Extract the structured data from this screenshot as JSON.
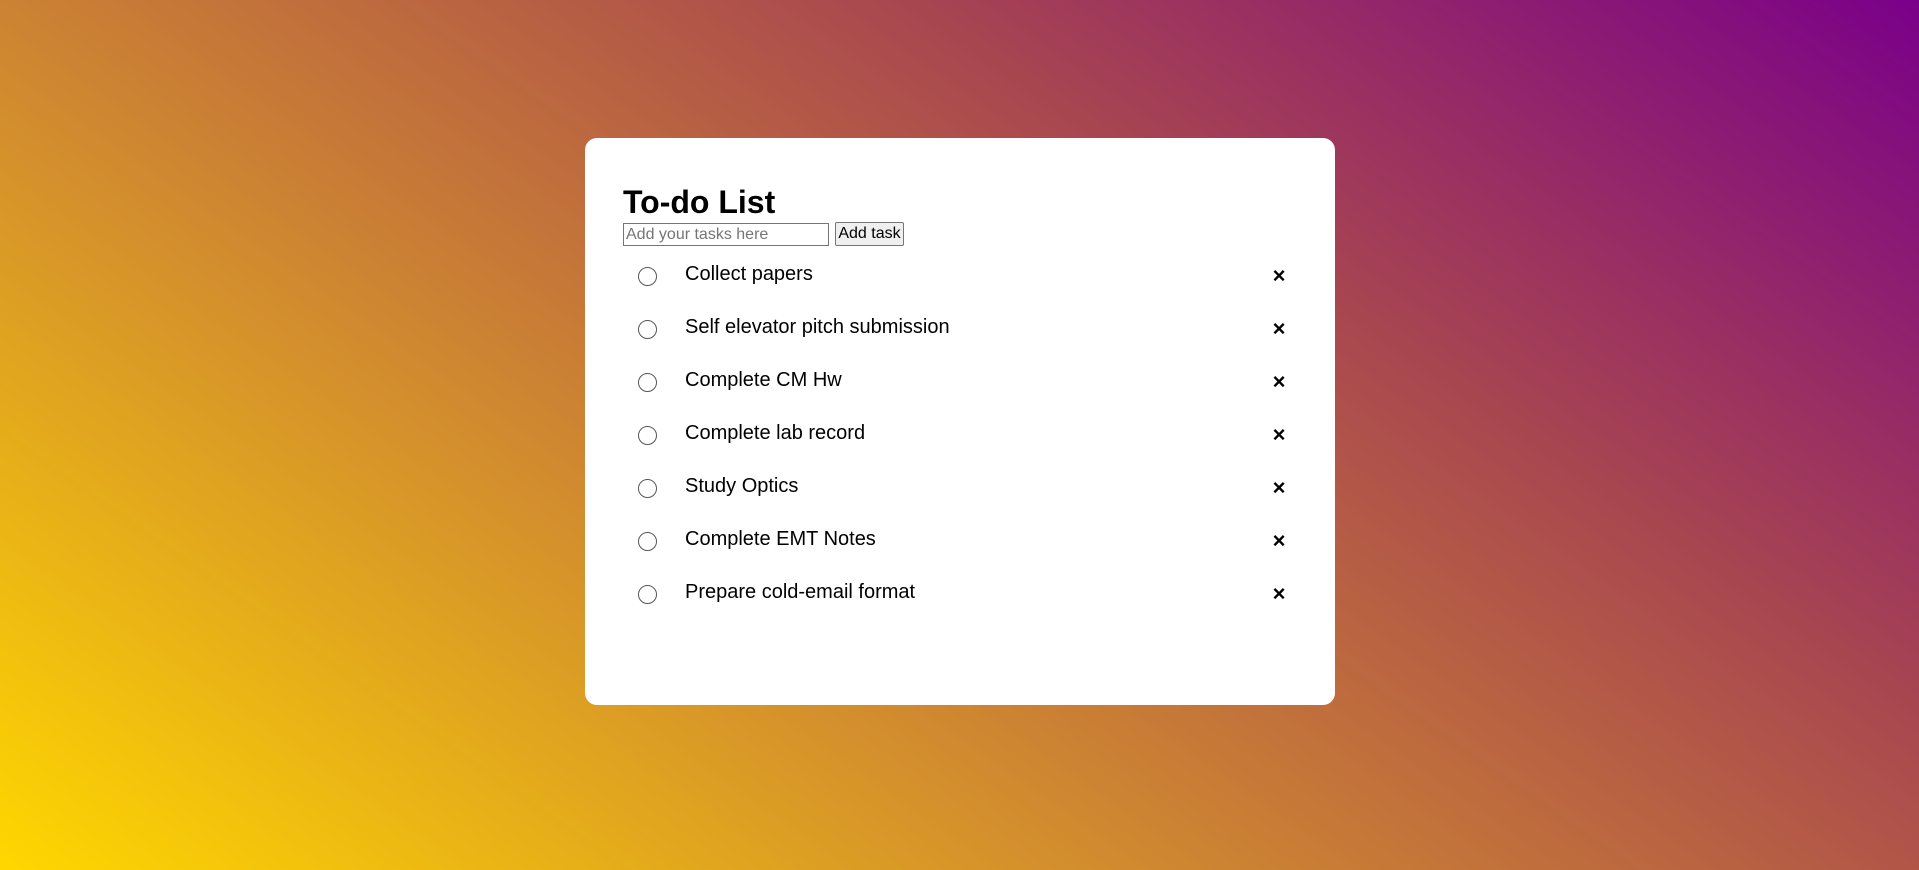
{
  "app": {
    "title": "To-do List"
  },
  "input": {
    "placeholder": "Add your tasks here",
    "value": ""
  },
  "add_button": {
    "label": "Add task"
  },
  "tasks": [
    {
      "text": "Collect papers",
      "checked": false,
      "delete_icon": "×"
    },
    {
      "text": "Self elevator pitch submission",
      "checked": false,
      "delete_icon": "×"
    },
    {
      "text": "Complete CM Hw",
      "checked": false,
      "delete_icon": "×"
    },
    {
      "text": "Complete lab record",
      "checked": false,
      "delete_icon": "×"
    },
    {
      "text": "Study Optics",
      "checked": false,
      "delete_icon": "×"
    },
    {
      "text": "Complete EMT Notes",
      "checked": false,
      "delete_icon": "×"
    },
    {
      "text": "Prepare cold-email format",
      "checked": false,
      "delete_icon": "×"
    }
  ],
  "colors": {
    "gradient_start": "#ffd700",
    "gradient_mid": "#c87a3a",
    "gradient_end": "#7a0089",
    "card_background": "#ffffff"
  }
}
